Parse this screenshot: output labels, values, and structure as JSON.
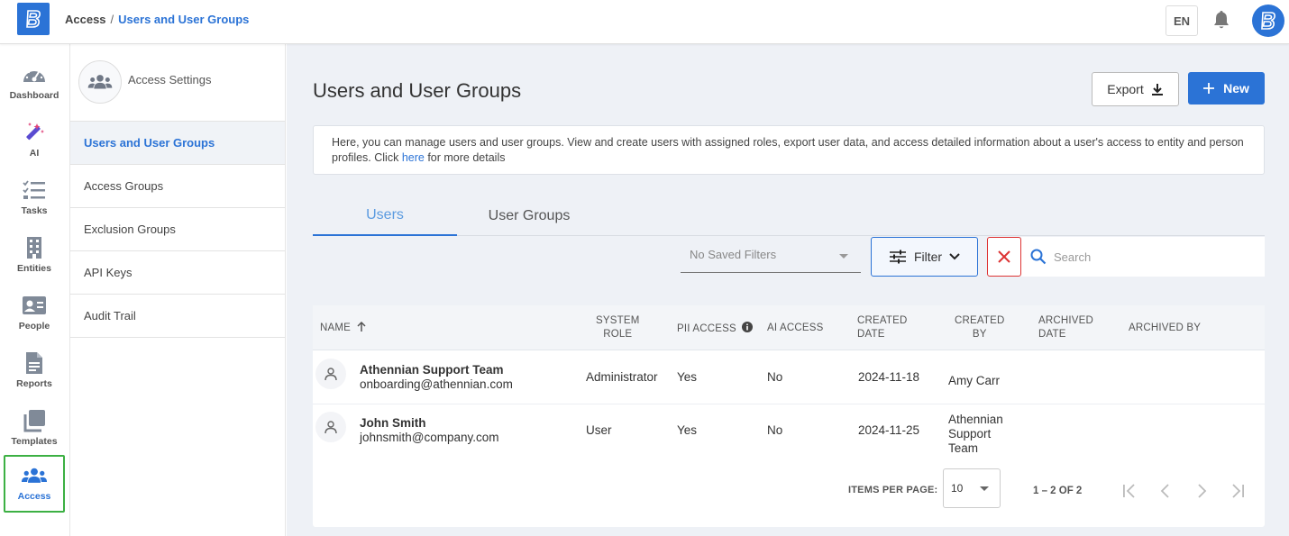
{
  "topbar": {
    "breadcrumb_root": "Access",
    "breadcrumb_separator": "/",
    "breadcrumb_current": "Users and User Groups",
    "language": "EN"
  },
  "nav": {
    "items": [
      {
        "label": "Dashboard",
        "icon": "gauge-icon"
      },
      {
        "label": "AI",
        "icon": "magic-wand-icon"
      },
      {
        "label": "Tasks",
        "icon": "checklist-icon"
      },
      {
        "label": "Entities",
        "icon": "building-icon"
      },
      {
        "label": "People",
        "icon": "id-card-icon"
      },
      {
        "label": "Reports",
        "icon": "document-icon"
      },
      {
        "label": "Templates",
        "icon": "copy-icon"
      },
      {
        "label": "Access",
        "icon": "users-icon"
      }
    ],
    "active": "Access"
  },
  "settings": {
    "title": "Access Settings",
    "items": [
      {
        "label": "Users and User Groups"
      },
      {
        "label": "Access Groups"
      },
      {
        "label": "Exclusion Groups"
      },
      {
        "label": "API Keys"
      },
      {
        "label": "Audit Trail"
      }
    ]
  },
  "main": {
    "title": "Users and User Groups",
    "export_label": "Export",
    "new_label": "New",
    "info_text": "Here, you can manage users and user groups. View and create users with assigned roles, export user data, and access detailed information about a user's access to entity and person profiles. Click",
    "info_link": "here",
    "info_suffix": "for more details",
    "tabs": [
      {
        "label": "Users"
      },
      {
        "label": "User Groups"
      }
    ],
    "saved_filters_placeholder": "No Saved Filters",
    "filter_label": "Filter",
    "search_placeholder": "Search"
  },
  "table": {
    "headers": {
      "name": "NAME",
      "system_role_1": "SYSTEM",
      "system_role_2": "ROLE",
      "pii_access": "PII ACCESS",
      "ai_access": "AI ACCESS",
      "created_date_1": "CREATED",
      "created_date_2": "DATE",
      "created_by_1": "CREATED",
      "created_by_2": "BY",
      "archived_date_1": "ARCHIVED",
      "archived_date_2": "DATE",
      "archived_by": "ARCHIVED BY"
    },
    "rows": [
      {
        "name": "Athennian Support Team",
        "email": "onboarding@athennian.com",
        "system_role": "Administrator",
        "pii_access": "Yes",
        "ai_access": "No",
        "created_date": "2024-11-18",
        "created_by": "Amy Carr",
        "created_by_2": "",
        "created_by_3": ""
      },
      {
        "name": "John Smith",
        "email": "johnsmith@company.com",
        "system_role": "User",
        "pii_access": "Yes",
        "ai_access": "No",
        "created_date": "2024-11-25",
        "created_by": "Athennian",
        "created_by_2": "Support",
        "created_by_3": "Team"
      }
    ]
  },
  "pagination": {
    "items_per_page_label": "ITEMS PER PAGE:",
    "items_per_page": "10",
    "range": "1 – 2 OF 2"
  },
  "colors": {
    "accent": "#2b73d6",
    "active_nav_border": "#3cb043",
    "clear_red": "#d33333",
    "main_bg": "#eef1f6"
  }
}
